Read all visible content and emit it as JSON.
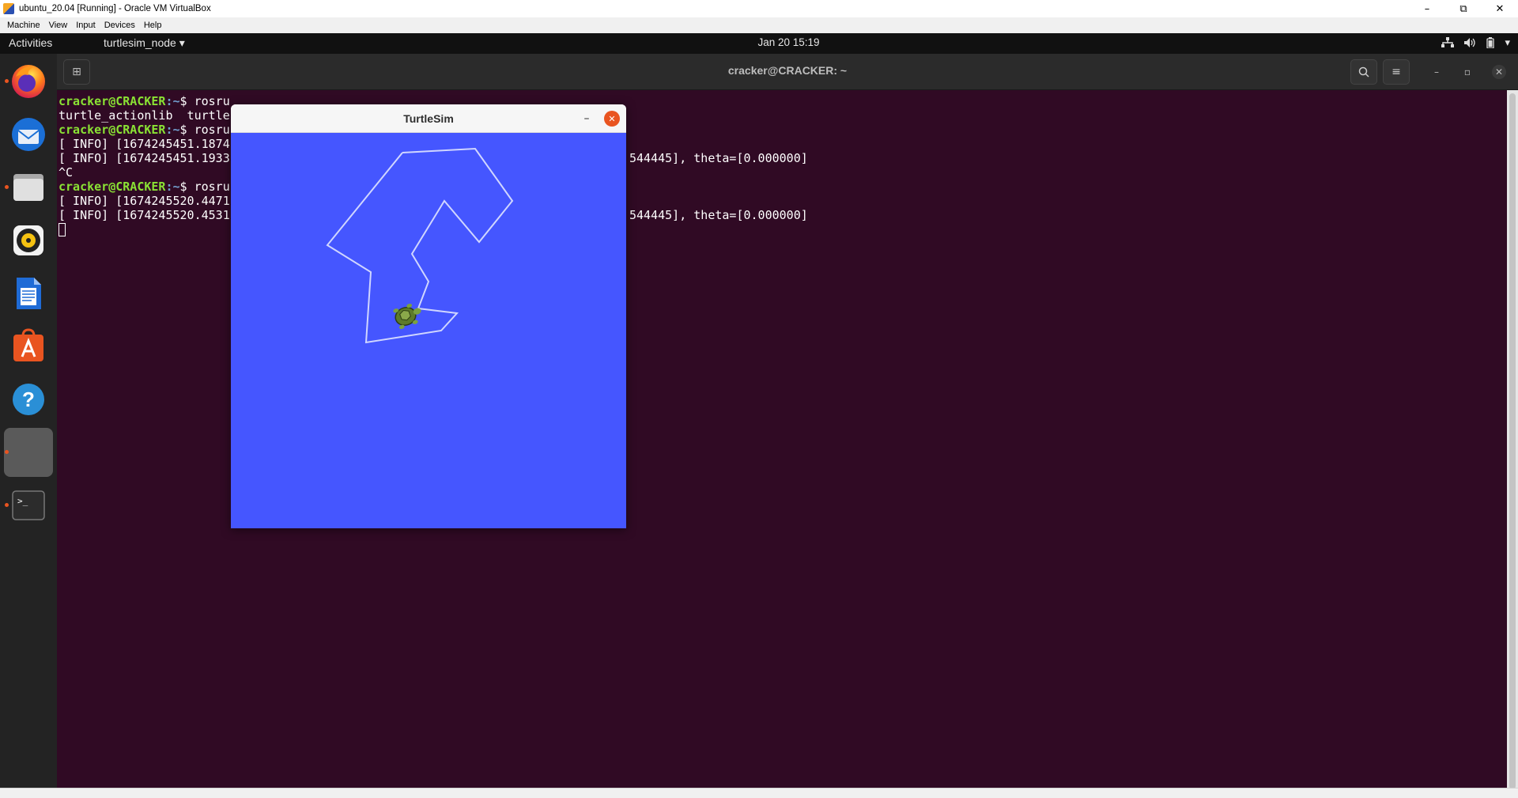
{
  "host": {
    "window_title": "ubuntu_20.04 [Running] - Oracle VM VirtualBox",
    "menu": [
      "Machine",
      "View",
      "Input",
      "Devices",
      "Help"
    ],
    "controls": {
      "minimize": "–",
      "restore": "⧉",
      "close": "✕"
    }
  },
  "gnome": {
    "activities": "Activities",
    "app_menu": "turtlesim_node ▾",
    "clock": "Jan 20  15:19",
    "tray": {
      "network": "⧉",
      "volume": "🔊",
      "battery": "▯",
      "menu": "▾"
    }
  },
  "dock": {
    "items": [
      {
        "name": "firefox-icon",
        "running": true
      },
      {
        "name": "thunderbird-icon",
        "running": false
      },
      {
        "name": "files-icon",
        "running": true
      },
      {
        "name": "rhythmbox-icon",
        "running": false
      },
      {
        "name": "libreoffice-writer-icon",
        "running": false
      },
      {
        "name": "ubuntu-software-icon",
        "running": false
      },
      {
        "name": "help-icon",
        "running": false
      },
      {
        "name": "turtlesim-app-icon",
        "running": true,
        "active": true
      },
      {
        "name": "terminal-icon",
        "running": true
      }
    ],
    "help_glyph": "?",
    "terminal_glyph": ">_"
  },
  "terminal": {
    "title": "cracker@CRACKER: ~",
    "lines": [
      {
        "user": "cracker@CRACKER",
        "path": ":~",
        "text": "$ rosru"
      },
      {
        "text": "turtle_actionlib  turtle"
      },
      {
        "user": "cracker@CRACKER",
        "path": ":~",
        "text": "$ rosru"
      },
      {
        "text": "[ INFO] [1674245451.1874"
      },
      {
        "text": "[ INFO] [1674245451.1933",
        "tail": "544445], theta=[0.000000]"
      },
      {
        "text": "^C"
      },
      {
        "user": "cracker@CRACKER",
        "path": ":~",
        "text": "$ rosru"
      },
      {
        "text": "[ INFO] [1674245520.4471"
      },
      {
        "text": "[ INFO] [1674245520.4531",
        "tail": "544445], theta=[0.000000]"
      }
    ],
    "header_icons": {
      "new_tab": "⊞",
      "search": "⌕",
      "menu": "≡",
      "minimize": "–",
      "maximize": "▫",
      "close": "✕"
    }
  },
  "turtlesim": {
    "title": "TurtleSim",
    "minimize": "–",
    "close": "✕",
    "background": "#4556ff",
    "trail_color": "#d0d6ff"
  }
}
